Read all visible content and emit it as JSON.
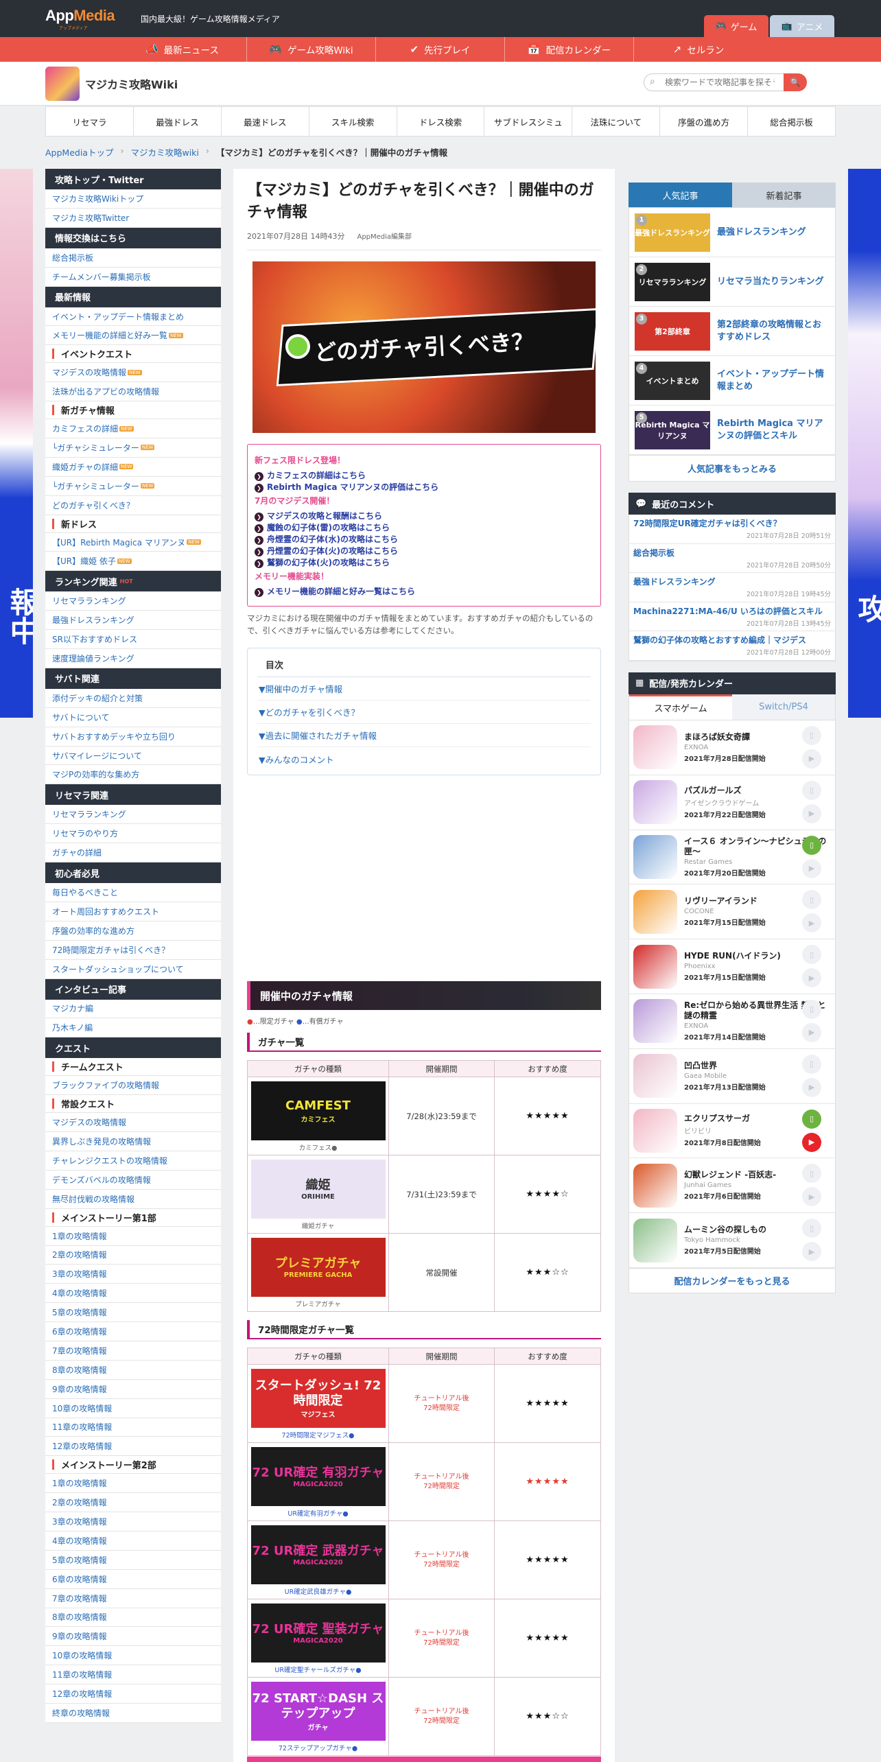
{
  "header": {
    "logo_text_a": "App",
    "logo_text_b": "Media",
    "logo_sub": "アップメディア",
    "tagline": "国内最大級！ゲーム攻略情報メディア",
    "tab_game": "ゲーム",
    "tab_anime": "アニメ"
  },
  "nav": [
    {
      "label": "最新ニュース",
      "icon": "megaphone-icon",
      "glyph": "📣"
    },
    {
      "label": "ゲーム攻略Wiki",
      "icon": "gamepad-icon",
      "glyph": "🎮"
    },
    {
      "label": "先行プレイ",
      "icon": "check-circle-icon",
      "glyph": "✔"
    },
    {
      "label": "配信カレンダー",
      "icon": "calendar-icon",
      "glyph": "📅"
    },
    {
      "label": "セルラン",
      "icon": "trend-up-icon",
      "glyph": "↗"
    }
  ],
  "site": {
    "title": "マジカミ攻略Wiki",
    "search_placeholder": "検索ワードで攻略記事を探そう！",
    "search_button": "🔍"
  },
  "subnav": [
    "リセマラ",
    "最強ドレス",
    "最速ドレス",
    "スキル検索",
    "ドレス検索",
    "サブドレスシミュ",
    "法珠について",
    "序盤の進め方",
    "総合掲示板"
  ],
  "breadcrumb": [
    "AppMediaトップ",
    "マジカミ攻略wiki",
    "【マジカミ】どのガチャを引くべき？｜開催中のガチャ情報"
  ],
  "breadcrumb_sep": "›",
  "side_ads": {
    "left": "報中",
    "right": "攻"
  },
  "left_sidebar": [
    {
      "type": "h",
      "text": "攻略トップ・Twitter"
    },
    {
      "type": "it",
      "text": "マジカミ攻略Wikiトップ"
    },
    {
      "type": "it",
      "text": "マジカミ攻略Twitter"
    },
    {
      "type": "h",
      "text": "情報交換はこちら"
    },
    {
      "type": "it",
      "text": "総合掲示板"
    },
    {
      "type": "it",
      "text": "チームメンバー募集掲示板"
    },
    {
      "type": "h",
      "text": "最新情報"
    },
    {
      "type": "it",
      "text": "イベント・アップデート情報まとめ"
    },
    {
      "type": "it",
      "text": "メモリー機能の詳細と好み一覧",
      "new": "NEW"
    },
    {
      "type": "sh",
      "text": "イベントクエスト"
    },
    {
      "type": "it",
      "text": "マジデスの攻略情報",
      "new": "NEW"
    },
    {
      "type": "it",
      "text": "法珠が出るアプビの攻略情報"
    },
    {
      "type": "sh",
      "text": "新ガチャ情報"
    },
    {
      "type": "it",
      "text": "カミフェスの詳細",
      "new": "NEW"
    },
    {
      "type": "it",
      "text": "└ガチャシミュレーター",
      "new": "NEW"
    },
    {
      "type": "it",
      "text": "織姫ガチャの詳細",
      "new": "NEW"
    },
    {
      "type": "it",
      "text": "└ガチャシミュレーター",
      "new": "NEW"
    },
    {
      "type": "it",
      "text": "どのガチャ引くべき？"
    },
    {
      "type": "sh",
      "text": "新ドレス"
    },
    {
      "type": "it",
      "text": "【UR】Rebirth Magica マリアンヌ",
      "new": "NEW"
    },
    {
      "type": "it",
      "text": "【UR】織姫 依子",
      "new": "NEW"
    },
    {
      "type": "h",
      "text": "ランキング関連",
      "hot": "HOT"
    },
    {
      "type": "it",
      "text": "リセマラランキング"
    },
    {
      "type": "it",
      "text": "最強ドレスランキング"
    },
    {
      "type": "it",
      "text": "SR以下おすすめドレス"
    },
    {
      "type": "it",
      "text": "速度理論値ランキング"
    },
    {
      "type": "h",
      "text": "サバト関連"
    },
    {
      "type": "it",
      "text": "添付デッキの紹介と対策"
    },
    {
      "type": "it",
      "text": "サバトについて"
    },
    {
      "type": "it",
      "text": "サバトおすすめデッキや立ち回り"
    },
    {
      "type": "it",
      "text": "サバマイレージについて"
    },
    {
      "type": "it",
      "text": "マジPの効率的な集め方"
    },
    {
      "type": "h",
      "text": "リセマラ関連"
    },
    {
      "type": "it",
      "text": "リセマラランキング"
    },
    {
      "type": "it",
      "text": "リセマラのやり方"
    },
    {
      "type": "it",
      "text": "ガチャの詳細"
    },
    {
      "type": "h",
      "text": "初心者必見"
    },
    {
      "type": "it",
      "text": "毎日やるべきこと"
    },
    {
      "type": "it",
      "text": "オート周回おすすめクエスト"
    },
    {
      "type": "it",
      "text": "序盤の効率的な進め方"
    },
    {
      "type": "it",
      "text": "72時間限定ガチャは引くべき？"
    },
    {
      "type": "it",
      "text": "スタートダッシュショップについて"
    },
    {
      "type": "h",
      "text": "インタビュー記事"
    },
    {
      "type": "it",
      "text": "マジカナ編"
    },
    {
      "type": "it",
      "text": "乃木キノ編"
    },
    {
      "type": "h",
      "text": "クエスト"
    },
    {
      "type": "sh",
      "text": "チームクエスト"
    },
    {
      "type": "it",
      "text": "ブラックファイブの攻略情報"
    },
    {
      "type": "sh",
      "text": "常設クエスト"
    },
    {
      "type": "it",
      "text": "マジデスの攻略情報"
    },
    {
      "type": "it",
      "text": "異界しぶき発見の攻略情報"
    },
    {
      "type": "it",
      "text": "チャレンジクエストの攻略情報"
    },
    {
      "type": "it",
      "text": "デモンズバベルの攻略情報"
    },
    {
      "type": "it",
      "text": "無尽討伐戦の攻略情報"
    },
    {
      "type": "sh",
      "text": "メインストーリー第1部"
    },
    {
      "type": "it",
      "text": "1章の攻略情報"
    },
    {
      "type": "it",
      "text": "2章の攻略情報"
    },
    {
      "type": "it",
      "text": "3章の攻略情報"
    },
    {
      "type": "it",
      "text": "4章の攻略情報"
    },
    {
      "type": "it",
      "text": "5章の攻略情報"
    },
    {
      "type": "it",
      "text": "6章の攻略情報"
    },
    {
      "type": "it",
      "text": "7章の攻略情報"
    },
    {
      "type": "it",
      "text": "8章の攻略情報"
    },
    {
      "type": "it",
      "text": "9章の攻略情報"
    },
    {
      "type": "it",
      "text": "10章の攻略情報"
    },
    {
      "type": "it",
      "text": "11章の攻略情報"
    },
    {
      "type": "it",
      "text": "12章の攻略情報"
    },
    {
      "type": "sh",
      "text": "メインストーリー第2部"
    },
    {
      "type": "it",
      "text": "1章の攻略情報"
    },
    {
      "type": "it",
      "text": "2章の攻略情報"
    },
    {
      "type": "it",
      "text": "3章の攻略情報"
    },
    {
      "type": "it",
      "text": "4章の攻略情報"
    },
    {
      "type": "it",
      "text": "5章の攻略情報"
    },
    {
      "type": "it",
      "text": "6章の攻略情報"
    },
    {
      "type": "it",
      "text": "7章の攻略情報"
    },
    {
      "type": "it",
      "text": "8章の攻略情報"
    },
    {
      "type": "it",
      "text": "9章の攻略情報"
    },
    {
      "type": "it",
      "text": "10章の攻略情報"
    },
    {
      "type": "it",
      "text": "11章の攻略情報"
    },
    {
      "type": "it",
      "text": "12章の攻略情報"
    },
    {
      "type": "it",
      "text": "終章の攻略情報"
    }
  ],
  "article": {
    "title": "【マジカミ】どのガチャを引くべき？｜開催中のガチャ情報",
    "date": "2021年07月28日 14時43分",
    "author": "AppMedia編集部",
    "hero_text": "どのガチャ引くべき？",
    "news_groups": [
      {
        "heading": "新フェス限ドレス登場！",
        "links": [
          "カミフェスの詳細はこちら",
          "Rebirth Magica マリアンヌの評価はこちら"
        ]
      },
      {
        "heading": "7月のマジデス開催！",
        "links": [
          "マジデスの攻略と報酬はこちら",
          "魔蝕の幻子体(雷)の攻略はこちら",
          "舟煙霊の幻子体(水)の攻略はこちら",
          "丹煙霊の幻子体(火)の攻略はこちら",
          "鷲獅の幻子体(火)の攻略はこちら"
        ]
      },
      {
        "heading": "メモリー機能実装！",
        "links": [
          "メモリー機能の詳細と好み一覧はこちら"
        ]
      }
    ],
    "intro": "マジカミにおける現在開催中のガチャ情報をまとめています。おすすめガチャの紹介もしているので、引くべきガチャに悩んでいる方は参考にしてください。",
    "toc_title": "目次",
    "toc": [
      "▼開催中のガチャ情報",
      "▼どのガチャを引くべき？",
      "▼過去に開催されたガチャ情報",
      "▼みんなのコメント"
    ],
    "section_title": "開催中のガチャ情報",
    "legend_a": "●",
    "legend_a_text": "…限定ガチャ",
    "legend_b": "●",
    "legend_b_text": "…有償ガチャ",
    "sub1": "ガチャ一覧",
    "sub2": "72時間限定ガチャ一覧",
    "table_headers": [
      "ガチャの種類",
      "開催期間",
      "おすすめ度"
    ],
    "gacha_list": [
      {
        "banner": "CAMFEST",
        "sub": "カミフェス",
        "caption": "カミフェス●",
        "period": "7/28(水)23:59まで",
        "stars": "★★★★★",
        "bg": "#151515",
        "fg": "#f3e53a"
      },
      {
        "banner": "織姫",
        "sub": "ORIHIME",
        "caption": "織姫ガチャ",
        "period": "7/31(土)23:59まで",
        "stars": "★★★★☆",
        "bg": "#e9e3f4",
        "fg": "#333"
      },
      {
        "banner": "プレミアガチャ",
        "sub": "PREMIERE GACHA",
        "caption": "プレミアガチャ",
        "period": "常設開催",
        "stars": "★★★☆☆",
        "bg": "#c0261f",
        "fg": "#f6d43a"
      }
    ],
    "gacha72": [
      {
        "banner": "スタートダッシュ! 72時間限定",
        "sub": "マジフェス",
        "caption": "72時間限定マジフェス●",
        "p1": "チュートリアル後",
        "p2": "72時間限定",
        "stars": "★★★★★",
        "red": false,
        "bg": "#d92d2d",
        "fg": "#fff"
      },
      {
        "banner": "72 UR確定 有羽ガチャ",
        "sub": "MAGICA2020",
        "caption": "UR確定有羽ガチャ●",
        "p1": "チュートリアル後",
        "p2": "72時間限定",
        "stars": "★★★★★",
        "red": true,
        "bg": "#1c1c1c",
        "fg": "#e9339a"
      },
      {
        "banner": "72 UR確定 武器ガチャ",
        "sub": "MAGICA2020",
        "caption": "UR確定武良雄ガチャ●",
        "p1": "チュートリアル後",
        "p2": "72時間限定",
        "stars": "★★★★★",
        "red": false,
        "bg": "#1c1c1c",
        "fg": "#e9339a"
      },
      {
        "banner": "72 UR確定 聖装ガチャ",
        "sub": "MAGICA2020",
        "caption": "UR確定聖チャールズガチャ●",
        "p1": "チュートリアル後",
        "p2": "72時間限定",
        "stars": "★★★★★",
        "red": false,
        "bg": "#1c1c1c",
        "fg": "#e9339a"
      },
      {
        "banner": "72 START☆DASH ステップアップ",
        "sub": "ガチャ",
        "caption": "72ステップアップガチャ●",
        "p1": "チュートリアル後",
        "p2": "72時間限定",
        "stars": "★★★☆☆",
        "red": false,
        "bg": "#b33ad6",
        "fg": "#fff"
      }
    ]
  },
  "right_sidebar": {
    "tab_popular": "人気記事",
    "tab_new": "新着記事",
    "popular": [
      {
        "rank": "1",
        "title": "最強ドレスランキング",
        "thumb": "最強ドレスランキング",
        "bg": "#e7b43a"
      },
      {
        "rank": "2",
        "title": "リセマラ当たりランキング",
        "thumb": "リセマラランキング",
        "bg": "#222"
      },
      {
        "rank": "3",
        "title": "第2部終章の攻略情報とおすすめドレス",
        "thumb": "第2部終章",
        "bg": "#d2352a"
      },
      {
        "rank": "4",
        "title": "イベント・アップデート情報まとめ",
        "thumb": "イベントまとめ",
        "bg": "#2d2d2d"
      },
      {
        "rank": "5",
        "title": "Rebirth Magica マリアンヌの評価とスキル",
        "thumb": "Rebirth Magica マリアンヌ",
        "bg": "#3a2b54"
      }
    ],
    "popular_more": "人気記事をもっとみる",
    "comments_title": "最近のコメント",
    "comments": [
      {
        "title": "72時間限定UR確定ガチャは引くべき？",
        "date": "2021年07月28日 20時51分"
      },
      {
        "title": "総合掲示板",
        "date": "2021年07月28日 20時50分"
      },
      {
        "title": "最強ドレスランキング",
        "date": "2021年07月28日 19時45分"
      },
      {
        "title": "Machina2271:MA-46/U いろはの評価とスキル",
        "date": "2021年07月28日 13時45分"
      },
      {
        "title": "鷲獅の幻子体の攻略とおすすめ編成｜マジデス",
        "date": "2021年07月28日 12時00分"
      }
    ],
    "calendar_title": "配信/発売カレンダー",
    "cal_tab_a": "スマホゲーム",
    "cal_tab_b": "Switch/PS4",
    "calendar": [
      {
        "name": "まほろば妖女奇譚",
        "company": "EXNOA",
        "date": "2021年7月28日配信開始",
        "color": "#f1b7c9",
        "a": "",
        "b": ""
      },
      {
        "name": "パズルガールズ",
        "company": "アイゼンクラウドゲーム",
        "date": "2021年7月22日配信開始",
        "color": "#c9a8e3",
        "a": "",
        "b": ""
      },
      {
        "name": "イース６ オンライン〜ナピシュテムの匣〜",
        "company": "Restar Games",
        "date": "2021年7月20日配信開始",
        "color": "#7aa3d6",
        "a": "green",
        "b": ""
      },
      {
        "name": "リヴリーアイランド",
        "company": "COCONE",
        "date": "2021年7月15日配信開始",
        "color": "#f3a13a",
        "a": "",
        "b": ""
      },
      {
        "name": "HYDE RUN(ハイドラン)",
        "company": "Phoenixx",
        "date": "2021年7月15日配信開始",
        "color": "#d22a2a",
        "a": "",
        "b": ""
      },
      {
        "name": "Re:ゼロから始める異世界生活 禁書と謎の精霊",
        "company": "EXNOA",
        "date": "2021年7月14日配信開始",
        "color": "#b89ad8",
        "a": "",
        "b": ""
      },
      {
        "name": "凹凸世界",
        "company": "Gaea Mobile",
        "date": "2021年7月13日配信開始",
        "color": "#e9c3d0",
        "a": "",
        "b": ""
      },
      {
        "name": "エクリプスサーガ",
        "company": "ビリビリ",
        "date": "2021年7月8日配信開始",
        "color": "#f2b6c4",
        "a": "green",
        "b": "red"
      },
      {
        "name": "幻獣レジェンド -百妖志-",
        "company": "Junhai Games",
        "date": "2021年7月6日配信開始",
        "color": "#d9582a",
        "a": "",
        "b": ""
      },
      {
        "name": "ムーミン谷の探しもの",
        "company": "Tokyo Hammock",
        "date": "2021年7月5日配信開始",
        "color": "#8bbf8a",
        "a": "",
        "b": ""
      }
    ],
    "calendar_more": "配信カレンダーをもっと見る"
  }
}
